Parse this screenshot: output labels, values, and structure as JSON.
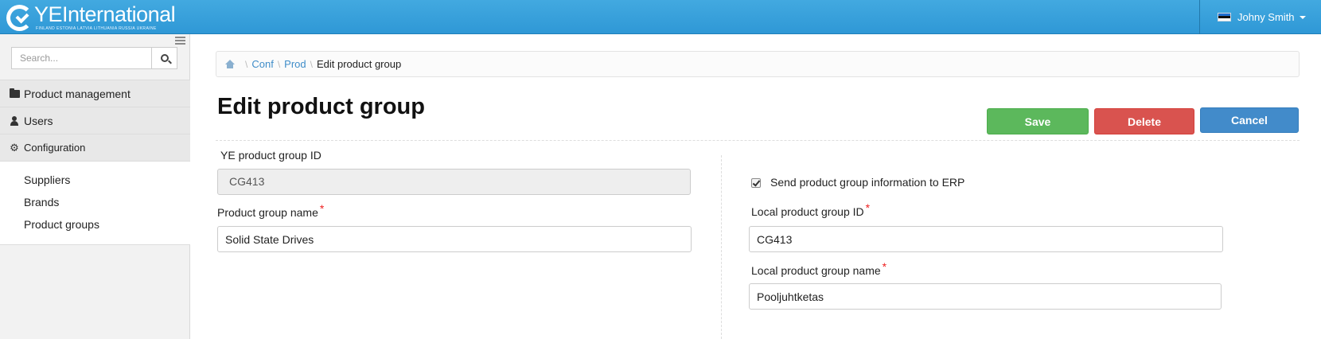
{
  "app": {
    "logo_text": "YEInternational",
    "logo_sub": "FINLAND  ESTONIA  LATVIA  LITHUANIA  RUSSIA  UKRAINE"
  },
  "user": {
    "name": "Johny Smith",
    "flag_colors": [
      "#1f6fd1",
      "#111111",
      "#ffffff"
    ]
  },
  "sidebar": {
    "search_placeholder": "Search...",
    "menu": [
      {
        "label": "Product management",
        "icon": "folder-icon"
      },
      {
        "label": "Users",
        "icon": "user-icon"
      },
      {
        "label": "Configuration",
        "icon": "gear-icon"
      }
    ],
    "submenu": [
      "Suppliers",
      "Brands",
      "Product groups"
    ]
  },
  "breadcrumb": {
    "items": [
      "Conf",
      "Prod"
    ],
    "current": "Edit product group"
  },
  "page": {
    "title": "Edit product group"
  },
  "actions": {
    "save": "Save",
    "delete": "Delete",
    "cancel": "Cancel"
  },
  "form": {
    "ye_id_label": "YE product group ID",
    "ye_id_value": "CG413",
    "name_label": "Product group name",
    "name_value": "Solid State Drives",
    "erp_label": "Send product group information to ERP",
    "erp_checked": true,
    "local_id_label": "Local product group ID",
    "local_id_value": "CG413",
    "local_name_label": "Local product group name",
    "local_name_value": "Pooljuhtketas",
    "required_mark": "*"
  },
  "colors": {
    "navbar": "#3aa3dc",
    "save": "#5cb85c",
    "delete": "#d9534f",
    "cancel": "#428bca",
    "link": "#3f8dc9"
  }
}
